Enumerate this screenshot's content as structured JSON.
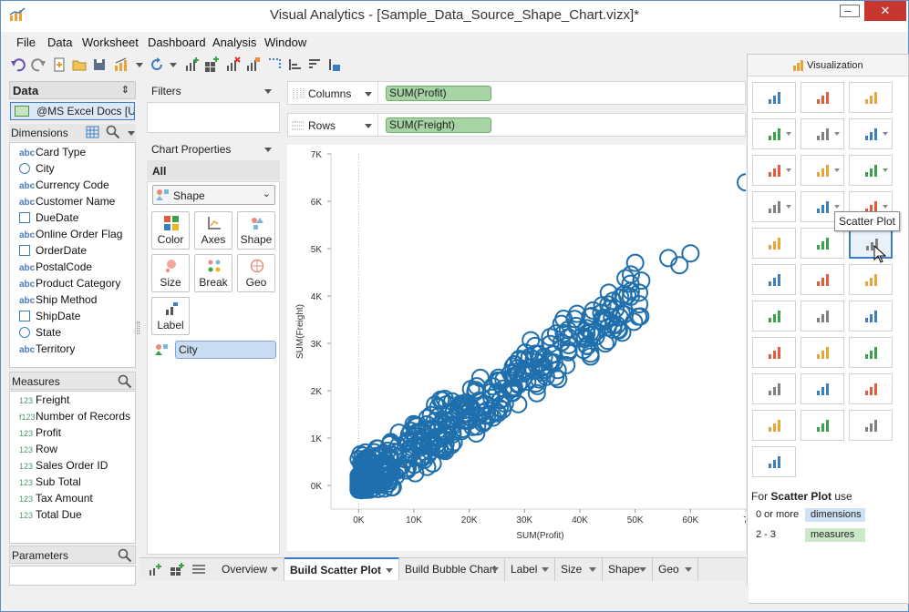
{
  "window": {
    "title": "Visual Analytics - [Sample_Data_Source_Shape_Chart.vizx]*",
    "minimize": "–",
    "maximize": "□",
    "close": "✕"
  },
  "menu": [
    "File",
    "Data",
    "Worksheet",
    "Dashboard",
    "Analysis",
    "Window"
  ],
  "data_panel": {
    "title": "Data",
    "source": "@MS Excel Docs [U..."
  },
  "dimensions": {
    "title": "Dimensions",
    "items": [
      {
        "label": "Card Type",
        "type": "abc"
      },
      {
        "label": "City",
        "type": "geo"
      },
      {
        "label": "Currency Code",
        "type": "abc"
      },
      {
        "label": "Customer Name",
        "type": "abc"
      },
      {
        "label": "DueDate",
        "type": "date"
      },
      {
        "label": "Online Order Flag",
        "type": "abc"
      },
      {
        "label": "OrderDate",
        "type": "date"
      },
      {
        "label": "PostalCode",
        "type": "abc"
      },
      {
        "label": "Product Category",
        "type": "abc"
      },
      {
        "label": "Ship Method",
        "type": "abc"
      },
      {
        "label": "ShipDate",
        "type": "date"
      },
      {
        "label": "State",
        "type": "geo"
      },
      {
        "label": "Territory",
        "type": "abc"
      }
    ]
  },
  "measures": {
    "title": "Measures",
    "items": [
      {
        "label": "Freight",
        "type": "123"
      },
      {
        "label": "Number of Records",
        "type": "fx123"
      },
      {
        "label": "Profit",
        "type": "123"
      },
      {
        "label": "Row",
        "type": "123"
      },
      {
        "label": "Sales Order ID",
        "type": "123"
      },
      {
        "label": "Sub Total",
        "type": "123"
      },
      {
        "label": "Tax Amount",
        "type": "123"
      },
      {
        "label": "Total Due",
        "type": "123"
      }
    ]
  },
  "parameters": {
    "title": "Parameters"
  },
  "filters": {
    "title": "Filters"
  },
  "chart_properties": {
    "title": "Chart Properties",
    "all": "All",
    "mark_type": "Shape",
    "buttons": [
      "Color",
      "Axes",
      "Shape",
      "Size",
      "Break",
      "Geo",
      "Label"
    ],
    "shape_field": "City"
  },
  "shelves": {
    "columns_label": "Columns",
    "rows_label": "Rows",
    "columns_pill": "SUM(Profit)",
    "rows_pill": "SUM(Freight)"
  },
  "chart_data": {
    "type": "scatter",
    "xlabel": "SUM(Profit)",
    "ylabel": "SUM(Freight)",
    "xlim": [
      -5000,
      70000
    ],
    "ylim": [
      -500,
      7000
    ],
    "x_ticks": [
      "0K",
      "10K",
      "20K",
      "30K",
      "40K",
      "50K",
      "60K",
      "7"
    ],
    "y_ticks": [
      "0K",
      "1K",
      "2K",
      "3K",
      "4K",
      "5K",
      "6K",
      "7K"
    ],
    "marker": "open-circle",
    "color": "#1f6fad"
  },
  "visualization": {
    "title": "Visualization",
    "tooltip": "Scatter Plot",
    "help_prefix": "For",
    "help_name": "Scatter Plot",
    "help_suffix": "use",
    "req1_count": "0 or more",
    "req1_label": "dimensions",
    "req2_count": "2 - 3",
    "req2_label": "measures"
  },
  "tabs": [
    "Overview",
    "Build Scatter Plot",
    "Build Bubble Chart",
    "Label",
    "Size",
    "Shape",
    "Geo"
  ],
  "active_tab": "Build Scatter Plot"
}
